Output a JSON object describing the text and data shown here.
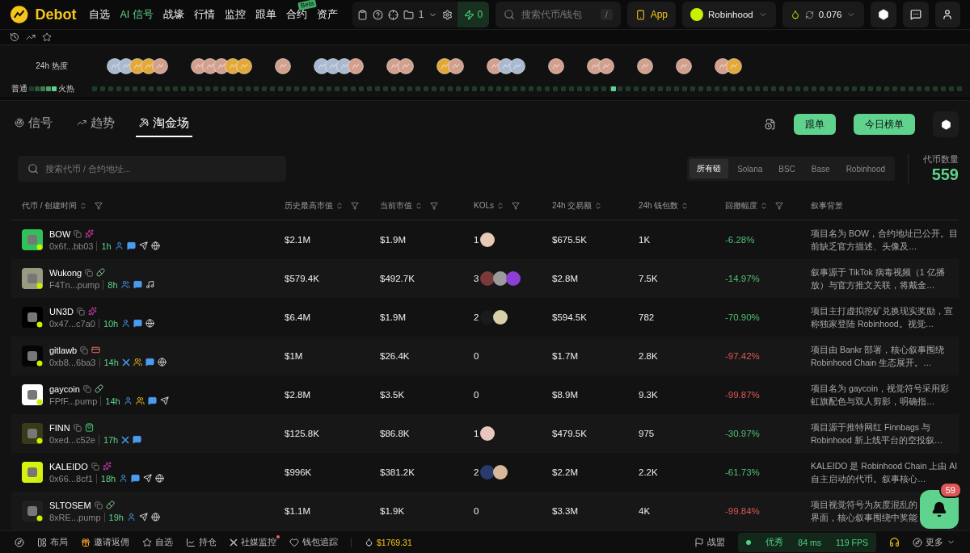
{
  "nav": {
    "brand": "Debot",
    "items": [
      {
        "label": "自选",
        "selected": false
      },
      {
        "label": "AI 信号",
        "selected": true
      },
      {
        "label": "战壕",
        "selected": false
      },
      {
        "label": "行情",
        "selected": false
      },
      {
        "label": "监控",
        "selected": false
      },
      {
        "label": "跟单",
        "selected": false
      },
      {
        "label": "合约",
        "selected": false,
        "badge": "Beta"
      },
      {
        "label": "资产",
        "selected": false
      }
    ],
    "wallet_count": "1",
    "boost": "0",
    "search": {
      "placeholder": "搜索代币/钱包",
      "shortcut": "/"
    },
    "app_button": "App",
    "chain": "Robinhood",
    "gas": "0.076"
  },
  "heat": {
    "label": "24h 热度",
    "legend_low": "普通",
    "legend_high": "火热",
    "level": 0.6,
    "clusters": [
      {
        "coins": [
          {
            "kind": "silver"
          },
          {
            "kind": "silver"
          },
          {
            "kind": "gold"
          },
          {
            "kind": "gold"
          },
          {
            "kind": "bronze"
          }
        ]
      },
      {
        "coins": [
          {
            "kind": "bronze"
          },
          {
            "kind": "bronze"
          },
          {
            "kind": "bronze"
          },
          {
            "kind": "gold"
          },
          {
            "kind": "gold"
          }
        ]
      },
      {
        "coins": [
          {
            "kind": "bronze"
          }
        ]
      },
      {
        "coins": [
          {
            "kind": "silver"
          },
          {
            "kind": "silver"
          },
          {
            "kind": "silver"
          },
          {
            "kind": "bronze"
          }
        ]
      },
      {
        "coins": [
          {
            "kind": "bronze"
          },
          {
            "kind": "bronze"
          }
        ]
      },
      {
        "coins": [
          {
            "kind": "gold"
          },
          {
            "kind": "bronze"
          }
        ]
      },
      {
        "coins": [
          {
            "kind": "bronze"
          },
          {
            "kind": "silver"
          },
          {
            "kind": "silver"
          }
        ]
      },
      {
        "coins": [
          {
            "kind": "bronze"
          }
        ]
      },
      {
        "coins": [
          {
            "kind": "bronze"
          },
          {
            "kind": "bronze"
          }
        ]
      },
      {
        "coins": [
          {
            "kind": "bronze"
          }
        ]
      },
      {
        "coins": [
          {
            "kind": "bronze"
          }
        ]
      },
      {
        "coins": [
          {
            "kind": "bronze"
          },
          {
            "kind": "gold"
          }
        ]
      }
    ]
  },
  "tabs": [
    {
      "label": "信号",
      "kind": "signal",
      "selected": false
    },
    {
      "label": "趋势",
      "kind": "trend",
      "selected": false
    },
    {
      "label": "淘金场",
      "kind": "dig",
      "selected": true
    }
  ],
  "actions": [
    "跟单",
    "今日榜单"
  ],
  "search": {
    "placeholder": "搜索代币 / 合约地址..."
  },
  "chains": [
    {
      "label": "所有链",
      "selected": true
    },
    {
      "label": "Solana",
      "selected": false
    },
    {
      "label": "BSC",
      "selected": false
    },
    {
      "label": "Base",
      "selected": false
    },
    {
      "label": "Robinhood",
      "selected": false
    }
  ],
  "token_count": {
    "label": "代币数量",
    "value": "559"
  },
  "table": {
    "columns": [
      {
        "label": "代币 / 创建时间",
        "sort": true,
        "filter": true
      },
      {
        "label": "历史最高市值",
        "sort": true,
        "filter": true
      },
      {
        "label": "当前市值",
        "sort": true,
        "filter": true
      },
      {
        "label": "KOLs",
        "sort": true,
        "filter": true
      },
      {
        "label": "24h 交易额",
        "sort": true,
        "filter": false
      },
      {
        "label": "24h 钱包数",
        "sort": true,
        "filter": false
      },
      {
        "label": "回撤幅度",
        "sort": true,
        "filter": true
      },
      {
        "label": "叙事背景",
        "sort": false,
        "filter": false
      }
    ],
    "rows": [
      {
        "name": "BOW",
        "tag": {
          "kind": "unicorn"
        },
        "color": "#2fc25b",
        "address": "0x6f...bb03",
        "age": "1h",
        "socials": [
          {
            "kind": "user"
          },
          {
            "kind": "chat"
          },
          {
            "kind": "telegram"
          },
          {
            "kind": "globe"
          }
        ],
        "ath": "$2.1M",
        "mcap": "$1.9M",
        "kols": "1",
        "kol_avatars": [
          {
            "color": "#e7c9b5"
          }
        ],
        "volume": "$675.5K",
        "wallets": "1K",
        "drawdown": "-6.28%",
        "severe": false,
        "narrative": "项目名为 BOW，合约地址已公开。目前缺乏官方描述、头像及…"
      },
      {
        "name": "Wukong",
        "tag": {
          "kind": "pill"
        },
        "color": "#9a9a80",
        "address": "F4Tn...pump",
        "age": "8h",
        "socials": [
          {
            "kind": "users"
          },
          {
            "kind": "chat"
          },
          {
            "kind": "tiktok"
          }
        ],
        "ath": "$579.4K",
        "mcap": "$492.7K",
        "kols": "3",
        "kol_avatars": [
          {
            "color": "#7a3a3a"
          },
          {
            "color": "#9a9a9a"
          },
          {
            "color": "#8c3fd6"
          }
        ],
        "volume": "$2.8M",
        "wallets": "7.5K",
        "drawdown": "-14.97%",
        "severe": false,
        "narrative": "叙事源于 TikTok 病毒视频（1 亿播放）与官方推文关联，将戴金…"
      },
      {
        "name": "UN3D",
        "tag": {
          "kind": "unicorn"
        },
        "color": "#000000",
        "address": "0x47...c7a0",
        "age": "10h",
        "socials": [
          {
            "kind": "user"
          },
          {
            "kind": "chat"
          },
          {
            "kind": "globe"
          }
        ],
        "ath": "$6.4M",
        "mcap": "$1.9M",
        "kols": "2",
        "kol_avatars": [
          {
            "color": "#1a1a1a"
          },
          {
            "color": "#d8d0a8"
          }
        ],
        "volume": "$594.5K",
        "wallets": "782",
        "drawdown": "-70.90%",
        "severe": false,
        "narrative": "项目主打虚拟挖矿兑换现实奖励，宣称独家登陆 Robinhood。视觉…"
      },
      {
        "name": "gitlawb",
        "tag": {
          "kind": "card"
        },
        "color": "#050505",
        "address": "0xb8...6ba3",
        "age": "14h",
        "socials": [
          {
            "kind": "x"
          },
          {
            "kind": "group"
          },
          {
            "kind": "chat"
          },
          {
            "kind": "globe"
          }
        ],
        "ath": "$1M",
        "mcap": "$26.4K",
        "kols": "0",
        "kol_avatars": [],
        "volume": "$1.7M",
        "wallets": "2.8K",
        "drawdown": "-97.42%",
        "severe": true,
        "narrative": "项目由 Bankr 部署，核心叙事围绕 Robinhood Chain 生态展开。…"
      },
      {
        "name": "gaycoin",
        "tag": {
          "kind": "pill"
        },
        "color": "#ffffff",
        "address": "FPfF...pump",
        "age": "14h",
        "socials": [
          {
            "kind": "user"
          },
          {
            "kind": "group"
          },
          {
            "kind": "chat"
          },
          {
            "kind": "telegram"
          }
        ],
        "ath": "$2.8M",
        "mcap": "$3.5K",
        "kols": "0",
        "kol_avatars": [],
        "volume": "$8.9M",
        "wallets": "9.3K",
        "drawdown": "-99.87%",
        "severe": true,
        "narrative": "项目名为 gaycoin，视觉符号采用彩虹旗配色与双人剪影，明确指…"
      },
      {
        "name": "FINN",
        "tag": {
          "kind": "bag"
        },
        "color": "#3a3a1a",
        "address": "0xed...c52e",
        "age": "17h",
        "socials": [
          {
            "kind": "x"
          },
          {
            "kind": "chat"
          }
        ],
        "ath": "$125.8K",
        "mcap": "$86.8K",
        "kols": "1",
        "kol_avatars": [
          {
            "color": "#e9c7c0"
          }
        ],
        "volume": "$479.5K",
        "wallets": "975",
        "drawdown": "-30.97%",
        "severe": false,
        "narrative": "项目源于推特网红 Finnbags 与 Robinhood 新上线平台的空投叙…"
      },
      {
        "name": "KALEIDO",
        "tag": {
          "kind": "unicorn"
        },
        "color": "#d7f20f",
        "address": "0x66...8cf1",
        "age": "18h",
        "socials": [
          {
            "kind": "user"
          },
          {
            "kind": "chat"
          },
          {
            "kind": "telegram"
          },
          {
            "kind": "globe"
          }
        ],
        "ath": "$996K",
        "mcap": "$381.2K",
        "kols": "2",
        "kol_avatars": [
          {
            "color": "#2a3a6a"
          },
          {
            "color": "#d9b89a"
          }
        ],
        "volume": "$2.2M",
        "wallets": "2.2K",
        "drawdown": "-61.73%",
        "severe": false,
        "narrative": "KALEIDO 是 Robinhood Chain 上由 AI 自主启动的代币。叙事核心…"
      },
      {
        "name": "SLTOSEM",
        "tag": {
          "kind": "pill"
        },
        "color": "#202020",
        "address": "8xRE...pump",
        "age": "19h",
        "socials": [
          {
            "kind": "user"
          },
          {
            "kind": "telegram"
          },
          {
            "kind": "globe"
          }
        ],
        "ath": "$1.1M",
        "mcap": "$1.9K",
        "kols": "0",
        "kol_avatars": [],
        "volume": "$3.3M",
        "wallets": "4K",
        "drawdown": "-99.84%",
        "severe": true,
        "narrative": "项目视觉符号为灰度混乱的界面，核心叙事围绕中奖能"
      }
    ]
  },
  "notifications": "59",
  "footer": {
    "items": [
      {
        "label": "布局",
        "kind": "layout",
        "dot": false
      },
      {
        "label": "邀请返佣",
        "kind": "gift",
        "dot": false
      },
      {
        "label": "自选",
        "kind": "star",
        "dot": false
      },
      {
        "label": "持仓",
        "kind": "chart",
        "dot": false
      },
      {
        "label": "社媒监控",
        "kind": "x",
        "dot": true
      },
      {
        "label": "钱包追踪",
        "kind": "heart",
        "dot": false
      }
    ],
    "price": "$1769.31",
    "alliance": "战盟",
    "status": "优秀",
    "latency": "84 ms",
    "fps": "119 FPS",
    "more": "更多"
  }
}
